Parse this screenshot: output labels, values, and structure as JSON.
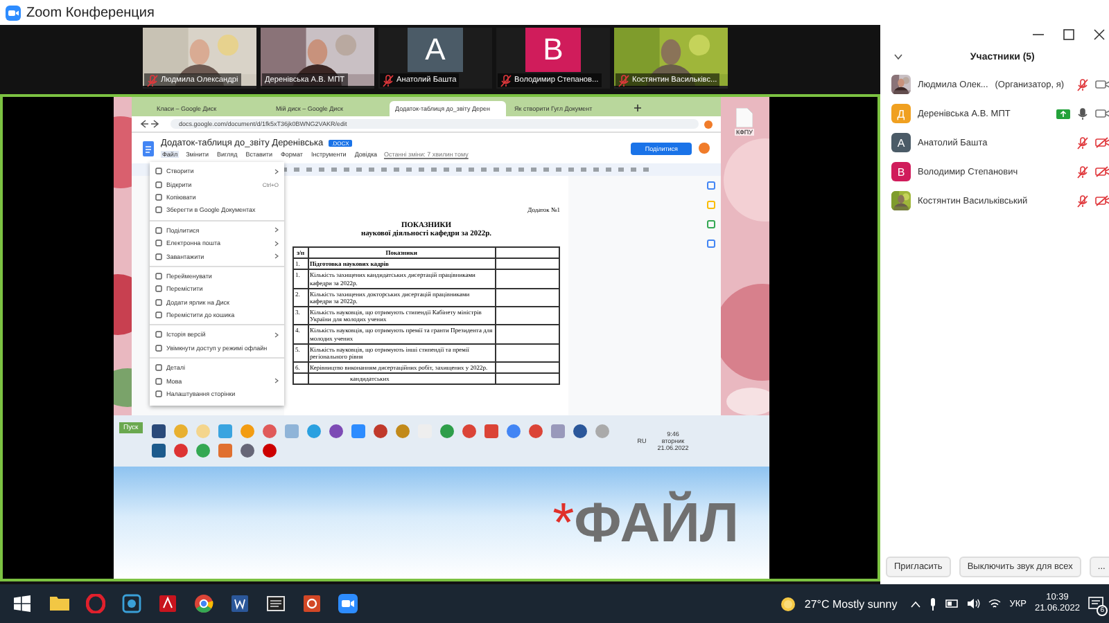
{
  "window": {
    "title": "Zoom Конференция"
  },
  "video_tiles": [
    {
      "name": "Людмила  Олександрі",
      "muted": true
    },
    {
      "name": "Деренівська А.В. МПТ",
      "muted": false
    },
    {
      "name": "Анатолий Башта",
      "kind": "letter",
      "letter": "A",
      "color": "#4b5b67",
      "muted": true
    },
    {
      "name": "Володимир Степанов...",
      "kind": "letter",
      "letter": "B",
      "color": "#d01c5b",
      "muted": true
    },
    {
      "name": "Костянтин Васильківс...",
      "muted": true
    }
  ],
  "shared_screen": {
    "browser": {
      "tabs": [
        {
          "label": "Класи – Google Диск",
          "selected": false
        },
        {
          "label": "Мій диск – Google Диск",
          "selected": false
        },
        {
          "label": "Додаток-таблиця до_звіту Дерен",
          "selected": true
        },
        {
          "label": "Як створити Гугл Документ",
          "selected": false
        }
      ],
      "address": "docs.google.com/document/d/1fk5xT36jk0BWNG2VAKR/edit",
      "doc_title": "Додаток-таблиця до_звіту Деренівська",
      "doc_badge": ".DOCX",
      "menu": [
        {
          "label": "Файл",
          "selected": true
        },
        {
          "label": "Змінити",
          "selected": false
        },
        {
          "label": "Вигляд",
          "selected": false
        },
        {
          "label": "Вставити",
          "selected": false
        },
        {
          "label": "Формат",
          "selected": false
        },
        {
          "label": "Інструменти",
          "selected": false
        },
        {
          "label": "Довідка",
          "selected": false
        }
      ],
      "last_edit": "Останні зміни: 7 хвилин тому",
      "share_button": "Поділитися",
      "file_menu": [
        [
          {
            "label": "Створити",
            "submenu": true
          },
          {
            "label": "Відкрити",
            "shortcut": "Ctrl+O",
            "submenu": false
          },
          {
            "label": "Копіювати",
            "submenu": false
          },
          {
            "label": "Зберегти в Google Документах",
            "submenu": false
          }
        ],
        [
          {
            "label": "Поділитися",
            "submenu": true
          },
          {
            "label": "Електронна пошта",
            "submenu": true
          },
          {
            "label": "Завантажити",
            "submenu": true
          }
        ],
        [
          {
            "label": "Перейменувати",
            "submenu": false
          },
          {
            "label": "Перемістити",
            "submenu": false
          },
          {
            "label": "Додати ярлик на Диск",
            "submenu": false
          },
          {
            "label": "Перемістити до кошика",
            "submenu": false
          }
        ],
        [
          {
            "label": "Історія версій",
            "submenu": true
          },
          {
            "label": "Увімкнути доступ у режимі офлайн",
            "submenu": false
          }
        ],
        [
          {
            "label": "Деталі",
            "submenu": false
          },
          {
            "label": "Мова",
            "submenu": true
          },
          {
            "label": "Налаштування сторінки",
            "submenu": false
          }
        ]
      ],
      "document": {
        "note": "Додаток №1",
        "title": "ПОКАЗНИКИ",
        "subtitle": "наукової діяльності кафедри за 2022р.",
        "columns": [
          "з/п",
          "Показники"
        ],
        "rows": [
          {
            "kind": "heading",
            "number": "1.",
            "text": "Підготовка наукових кадрів"
          },
          {
            "kind": "row",
            "number": "1.",
            "text": "Кількість захищених кандидатських дисертацій працівниками кафедри  за 2022р."
          },
          {
            "kind": "row",
            "number": "2.",
            "text": "Кількість захищених докторських дисертацій працівниками кафедри за 2022р."
          },
          {
            "kind": "row",
            "number": "3.",
            "text": "Кількість науковців, що отримують стипендії Кабінету міністрів  України для молодих учених"
          },
          {
            "kind": "row",
            "number": "4.",
            "text": "Кількість науковців, що отримують  премії та гранти Президента для молодих учених"
          },
          {
            "kind": "row",
            "number": "5.",
            "text": "Кількість науковців, що отримують інші стипендії та премії регіонального рівня"
          },
          {
            "kind": "row",
            "number": "6.",
            "text": "Керівництво виконанням дисертаційних робіт, захищених у 2022р."
          },
          {
            "kind": "sub",
            "number": "",
            "text": "кандидатських"
          }
        ]
      }
    },
    "desktop_icon": "КФПУ",
    "taskbar": {
      "start": "Пуск",
      "language": "RU",
      "time": "9:46",
      "day": "вторник",
      "date": "21.06.2022"
    },
    "slide": {
      "mark": "*",
      "title": "ФАЙЛ"
    }
  },
  "participants": {
    "title": "Участники (5)",
    "items": [
      {
        "name": "Людмила  Олек...",
        "role": "(Организатор, я)",
        "muted": true,
        "video": true,
        "sharing": false
      },
      {
        "name": "Деренівська А.В. МПТ",
        "kind": "letter",
        "letter": "Д",
        "color": "#f0a020",
        "muted": false,
        "video": true,
        "sharing": true
      },
      {
        "name": "Анатолий Башта",
        "kind": "letter",
        "letter": "A",
        "color": "#4b5b67",
        "muted": true,
        "video": false,
        "sharing": false
      },
      {
        "name": "Володимир Степанович",
        "kind": "letter",
        "letter": "B",
        "color": "#d01c5b",
        "muted": true,
        "video": false,
        "sharing": false
      },
      {
        "name": "Костянтин Васильківський",
        "muted": true,
        "video": false,
        "sharing": false
      }
    ],
    "buttons": [
      "Пригласить",
      "Выключить звук для всех",
      "..."
    ]
  },
  "taskbar": {
    "weather": "27°C Mostly sunny",
    "language": "УКР",
    "time": "10:39",
    "date": "21.06.2022",
    "notifications": "6"
  }
}
